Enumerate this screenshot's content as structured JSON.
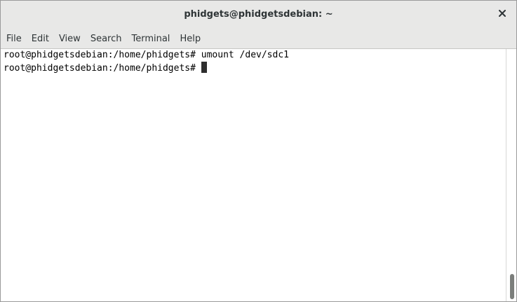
{
  "window": {
    "title": "phidgets@phidgetsdebian: ~"
  },
  "menu": [
    {
      "label": "File"
    },
    {
      "label": "Edit"
    },
    {
      "label": "View"
    },
    {
      "label": "Search"
    },
    {
      "label": "Terminal"
    },
    {
      "label": "Help"
    }
  ],
  "terminal": {
    "lines": [
      {
        "prompt": "root@phidgetsdebian:/home/phidgets#",
        "command": " umount /dev/sdc1"
      },
      {
        "prompt": "root@phidgetsdebian:/home/phidgets#",
        "command": " "
      }
    ]
  },
  "icons": {
    "close": "close-icon"
  },
  "colors": {
    "chrome": "#e8e8e7",
    "text": "#2e3436",
    "terminal_bg": "#ffffff",
    "terminal_fg": "#000000"
  }
}
